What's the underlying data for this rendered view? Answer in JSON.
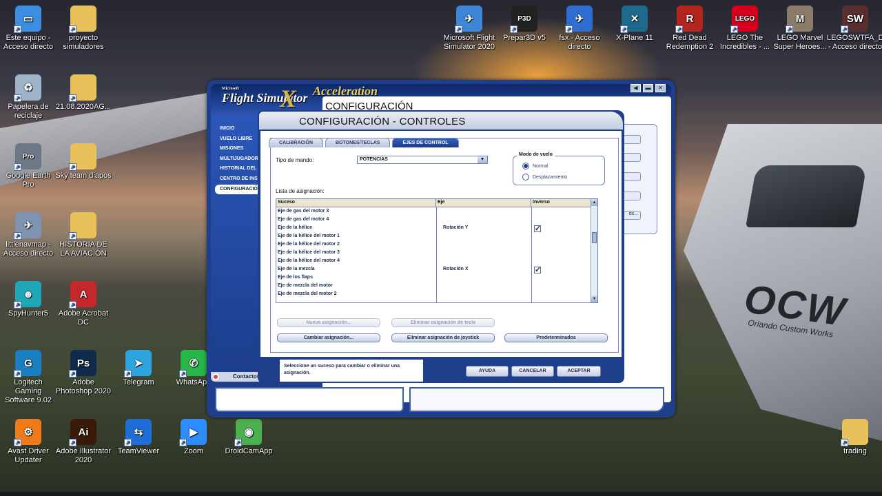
{
  "desktop": {
    "icons": [
      {
        "label": "Este equipo - Acceso directo",
        "icon": "computer-icon",
        "color": "#3b8ee0",
        "glyph": "▭"
      },
      {
        "label": "proyecto simuladores",
        "icon": "folder-icon",
        "color": "#e8c15a",
        "glyph": ""
      },
      {
        "label": "Papelera de reciclaje",
        "icon": "recycle-bin-icon",
        "color": "#9fb3c8",
        "glyph": "♻"
      },
      {
        "label": "21.08.2020AG...",
        "icon": "folder-icon",
        "color": "#e8c15a",
        "glyph": ""
      },
      {
        "label": "Google Earth Pro",
        "icon": "google-earth-icon",
        "color": "#6e7785",
        "glyph": "Pro"
      },
      {
        "label": "Sky team diapos",
        "icon": "folder-icon",
        "color": "#e8c15a",
        "glyph": ""
      },
      {
        "label": "littlenavmap - Acceso directo",
        "icon": "littlenavmap-icon",
        "color": "#7e93b0",
        "glyph": "✈"
      },
      {
        "label": "HISTORIA DE LA AVIACIÓN",
        "icon": "folder-icon",
        "color": "#e8c15a",
        "glyph": ""
      },
      {
        "label": "SpyHunter5",
        "icon": "spyhunter-icon",
        "color": "#1fa7b8",
        "glyph": "☻"
      },
      {
        "label": "Adobe Acrobat DC",
        "icon": "acrobat-icon",
        "color": "#c5282a",
        "glyph": "A"
      },
      {
        "label": "Logitech Gaming Software 9.02",
        "icon": "logitech-icon",
        "color": "#1b7fc4",
        "glyph": "G"
      },
      {
        "label": "Adobe Photoshop 2020",
        "icon": "photoshop-icon",
        "color": "#0f2a4a",
        "glyph": "Ps"
      },
      {
        "label": "Telegram",
        "icon": "telegram-icon",
        "color": "#2ea5de",
        "glyph": "➤"
      },
      {
        "label": "WhatsApp",
        "icon": "whatsapp-icon",
        "color": "#29b648",
        "glyph": "✆"
      },
      {
        "label": "Avast Driver Updater",
        "icon": "avast-driver-icon",
        "color": "#ef7a1a",
        "glyph": "⚙"
      },
      {
        "label": "Adobe Illustrator 2020",
        "icon": "illustrator-icon",
        "color": "#3a1a08",
        "glyph": "Ai"
      },
      {
        "label": "TeamViewer",
        "icon": "teamviewer-icon",
        "color": "#1f6ed8",
        "glyph": "⇆"
      },
      {
        "label": "Zoom",
        "icon": "zoom-icon",
        "color": "#2d8cff",
        "glyph": "▶"
      },
      {
        "label": "DroidCamApp",
        "icon": "droidcam-icon",
        "color": "#4caf50",
        "glyph": "◉"
      },
      {
        "label": "Microsoft Flight Simulator 2020",
        "icon": "msfs-icon",
        "color": "#3d86d8",
        "glyph": "✈"
      },
      {
        "label": "Prepar3D v5",
        "icon": "prepar3d-icon",
        "color": "#222",
        "glyph": "P3D"
      },
      {
        "label": "fsx - Acceso directo",
        "icon": "fsx-icon",
        "color": "#2f6ed0",
        "glyph": "✈"
      },
      {
        "label": "X-Plane 11",
        "icon": "xplane-icon",
        "color": "#1d6a8c",
        "glyph": "✕"
      },
      {
        "label": "Red Dead Redemption 2",
        "icon": "rdr2-icon",
        "color": "#b3261e",
        "glyph": "R"
      },
      {
        "label": "LEGO The Incredibles - ...",
        "icon": "lego-icon",
        "color": "#d6001c",
        "glyph": "LEGO"
      },
      {
        "label": "LEGO Marvel Super Heroes...",
        "icon": "lego-marvel-icon",
        "color": "#8a7c68",
        "glyph": "M"
      },
      {
        "label": "LEGOSWTFA_D... - Acceso directo",
        "icon": "lego-sw-icon",
        "color": "#5a2e2e",
        "glyph": "SW"
      },
      {
        "label": "trading",
        "icon": "folder-icon",
        "color": "#e8c15a",
        "glyph": ""
      }
    ]
  },
  "fsx": {
    "logo_small": "Microsoft",
    "logo": "Flight Simulator",
    "logo_x": "X",
    "logo_accel": "Acceleration",
    "page_title": "CONFIGURACIÓN",
    "nav": [
      "INICIO",
      "VUELO LIBRE",
      "MISIONES",
      "MULTIJUGADOR",
      "HISTORIAL DEL",
      "CENTRO DE INST",
      "CONFIGURACIÓ"
    ],
    "nav_selected": 6,
    "right_button_partial": "os...",
    "contacts": "Contactos"
  },
  "dialog": {
    "title": "CONFIGURACIÓN - CONTROLES",
    "tabs": [
      "CALIBRACIÓN",
      "BOTONES/TECLAS",
      "EJES DE CONTROL"
    ],
    "active_tab": 2,
    "controller_type_label": "Tipo de mando:",
    "controller_type_value": "POTENCIAS",
    "flight_mode": {
      "title": "Modo de vuelo",
      "options": [
        "Normal",
        "Desplazamiento"
      ],
      "selected": 0
    },
    "list_label": "Lista de asignación:",
    "columns": [
      "Suceso",
      "Eje",
      "Inverso"
    ],
    "rows": [
      {
        "event": "Eje de gas del motor 3",
        "axis": "",
        "inverse": false
      },
      {
        "event": "Eje de gas del motor 4",
        "axis": "",
        "inverse": false
      },
      {
        "event": "Eje de la hélice",
        "axis": "Rotación Y",
        "inverse": true
      },
      {
        "event": "Eje de la hélice del motor 1",
        "axis": "",
        "inverse": false
      },
      {
        "event": "Eje de la hélice del motor 2",
        "axis": "",
        "inverse": false
      },
      {
        "event": "Eje de la hélice del motor 3",
        "axis": "",
        "inverse": false
      },
      {
        "event": "Eje de la hélice del motor 4",
        "axis": "",
        "inverse": false
      },
      {
        "event": "Eje de la mezcla",
        "axis": "Rotación X",
        "inverse": true
      },
      {
        "event": "Eje de los flaps",
        "axis": "",
        "inverse": false
      },
      {
        "event": "Eje de mezcla del motor 1",
        "axis": "",
        "inverse": false
      },
      {
        "event": "Eje de mezcla del motor 2",
        "axis": "",
        "inverse": false
      }
    ],
    "buttons": {
      "new_assignment": "Nueva asignación...",
      "delete_key_assignment": "Eliminar asignación de tecla",
      "change_assignment": "Cambiar asignación...",
      "delete_joystick_assignment": "Eliminar asignación de joystick",
      "defaults": "Predeterminados"
    },
    "hint": "Seleccione un suceso para cambiar o eliminar una asignación.",
    "footer_buttons": {
      "help": "AYUDA",
      "cancel": "CANCELAR",
      "accept": "ACEPTAR"
    }
  }
}
